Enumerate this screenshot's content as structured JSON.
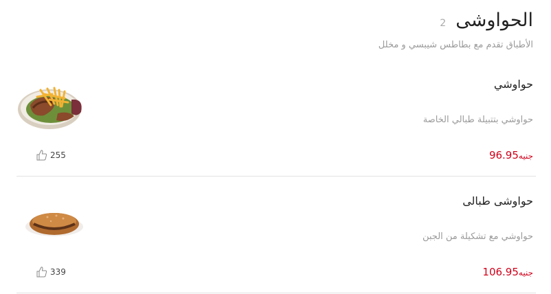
{
  "section": {
    "title": "الحواوشى",
    "count": "2",
    "description": "الأطباق تقدم مع بطاطس شيبسي و مخلل"
  },
  "items": [
    {
      "name": "حواوشي",
      "description": "حواوشي بتتبيلة طبالي الخاصة",
      "price": "96.95",
      "currency": "جنيه",
      "likes": "255",
      "image_icon": "sandwich-with-fries-icon"
    },
    {
      "name": "حواوشى طبالى",
      "description": "حواوشي مع تشكيلة من الجبن",
      "price": "106.95",
      "currency": "جنيه",
      "likes": "339",
      "image_icon": "stuffed-bread-icon"
    }
  ],
  "colors": {
    "price": "#d0021b",
    "muted": "#9a9a9a",
    "divider": "#e2e2e2"
  }
}
